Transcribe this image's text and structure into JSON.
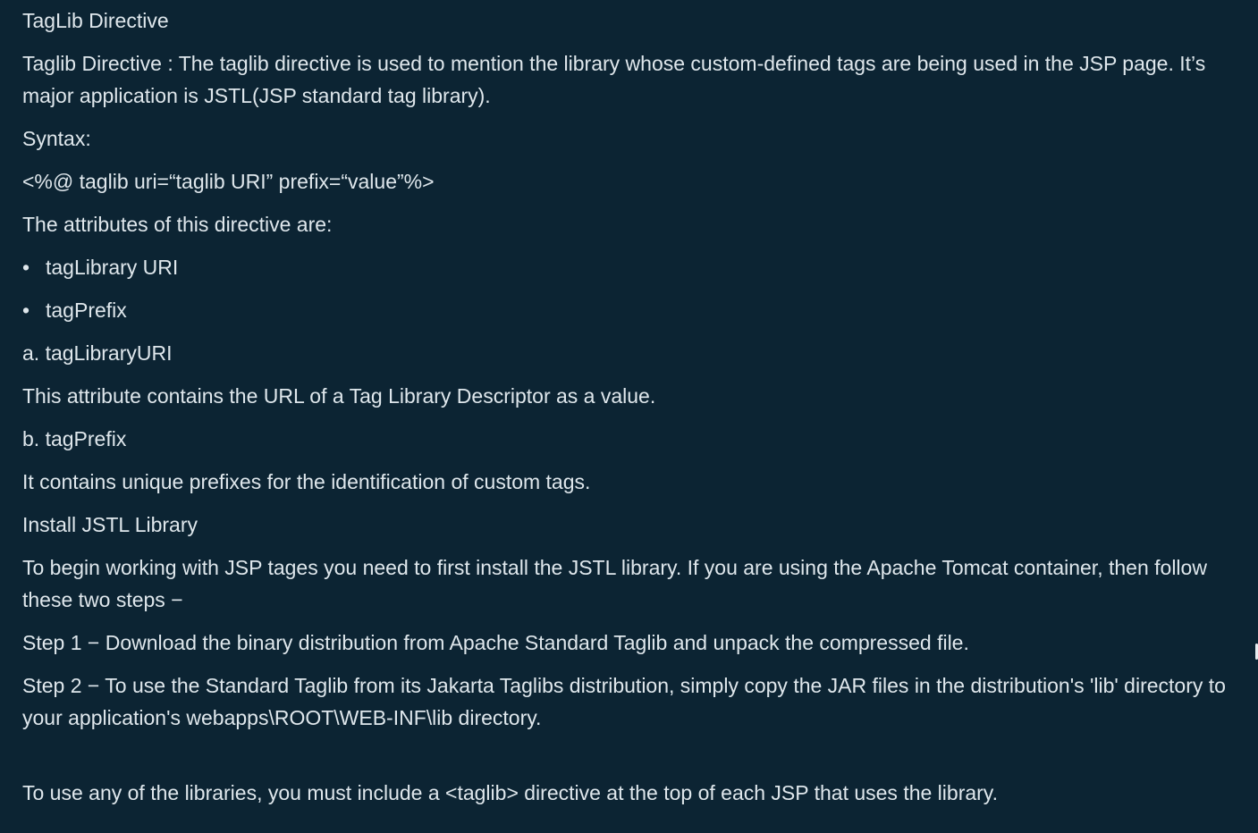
{
  "heading": "TagLib Directive",
  "intro": "Taglib Directive : The taglib directive is used to mention the library whose custom-defined tags are being used in the JSP page. It’s major application is JSTL(JSP standard tag library).",
  "syntax_label": "Syntax:",
  "syntax_code": "<%@ taglib uri=“taglib URI” prefix=“value”%>",
  "attributes_intro": "The attributes of this directive are:",
  "bullet_symbol": "•",
  "attributes": [
    "tagLibrary URI",
    "tagPrefix"
  ],
  "uri_heading": "a. tagLibraryURI",
  "uri_desc": "This attribute contains the URL of a Tag Library Descriptor as a value.",
  "prefix_heading": "b. tagPrefix",
  "prefix_desc": "It contains unique prefixes for the identification of custom tags.",
  "install_heading": "Install JSTL Library",
  "install_intro": "To begin working with JSP tages you need to first install the JSTL library. If you are using the Apache Tomcat container, then follow these two steps −",
  "step1": "Step 1 − Download the binary distribution from Apache Standard Taglib and unpack the compressed file.",
  "step2": "Step 2 − To use the Standard Taglib from its Jakarta Taglibs distribution, simply copy the JAR files in the distribution's 'lib' directory to your application's webapps\\ROOT\\WEB-INF\\lib directory.",
  "usage_note": "To use any of the libraries, you must include a <taglib> directive at the top of each JSP that uses the library."
}
